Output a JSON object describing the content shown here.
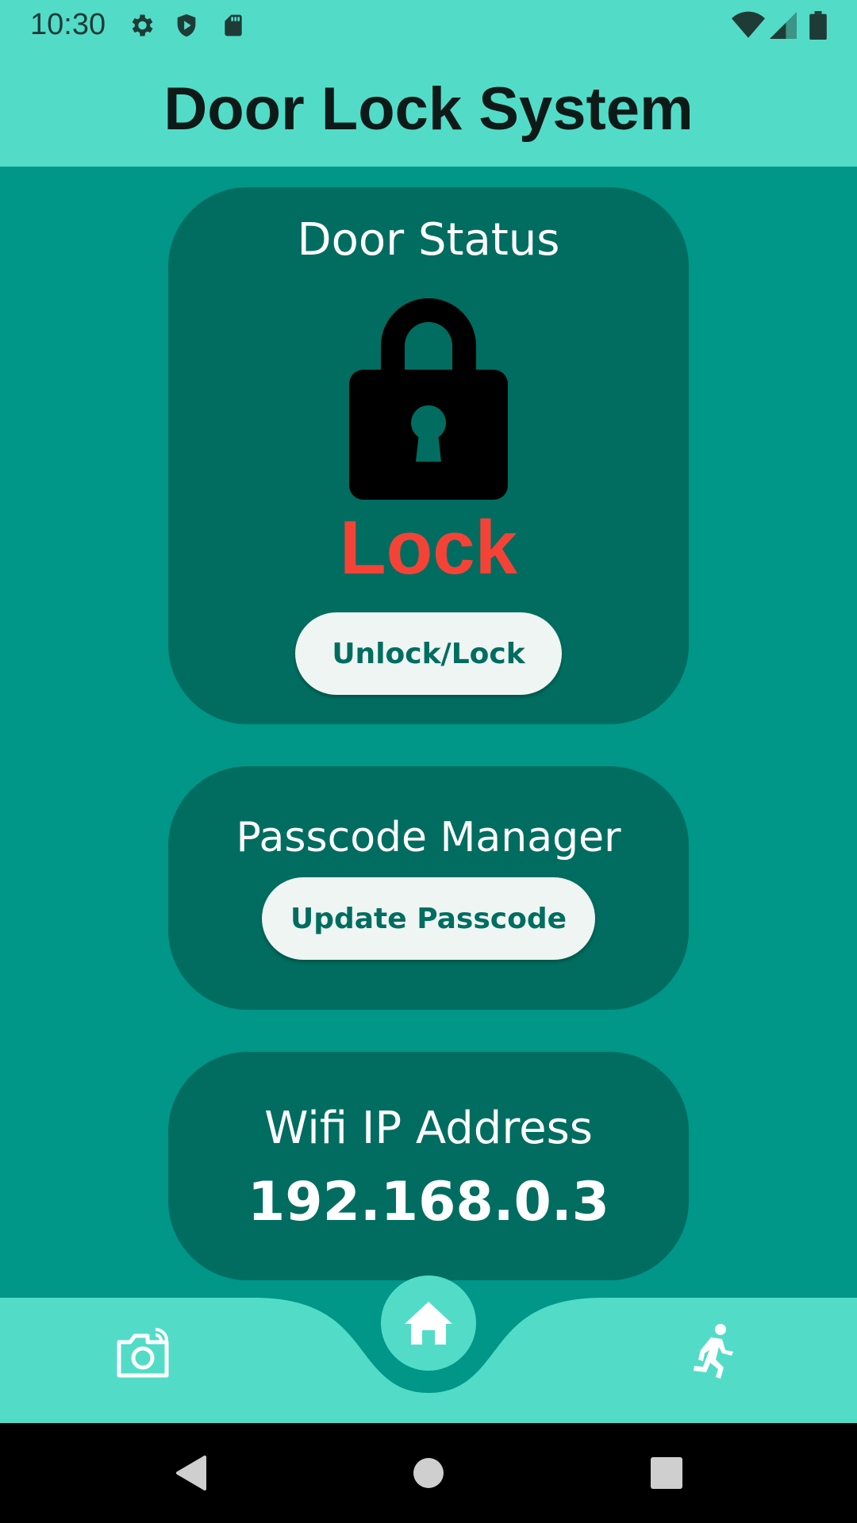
{
  "status_bar": {
    "time": "10:30",
    "left_icons": [
      "settings-icon",
      "shield-icon",
      "sd-card-icon"
    ],
    "right_icons": [
      "wifi-icon",
      "cell-signal-icon",
      "battery-icon"
    ]
  },
  "app_bar": {
    "title": "Door Lock System"
  },
  "door_status_card": {
    "heading": "Door Status",
    "icon": "padlock-icon",
    "state": "Lock",
    "button_label": "Unlock/Lock"
  },
  "passcode_card": {
    "heading": "Passcode Manager",
    "button_label": "Update Passcode"
  },
  "wifi_card": {
    "heading": "Wifi IP Address",
    "ip": "192.168.0.3"
  },
  "bottom_nav": {
    "items": [
      {
        "icon": "camera-icon"
      },
      {
        "icon": "home-icon",
        "selected": true
      },
      {
        "icon": "running-person-icon"
      }
    ]
  },
  "system_nav": {
    "items": [
      "back-icon",
      "home-circle-icon",
      "recents-icon"
    ]
  },
  "colors": {
    "accent": "#52DCC8",
    "background": "#009688",
    "card": "#006D60",
    "lock_state": "#F44336",
    "button": "#EEF5F2"
  }
}
